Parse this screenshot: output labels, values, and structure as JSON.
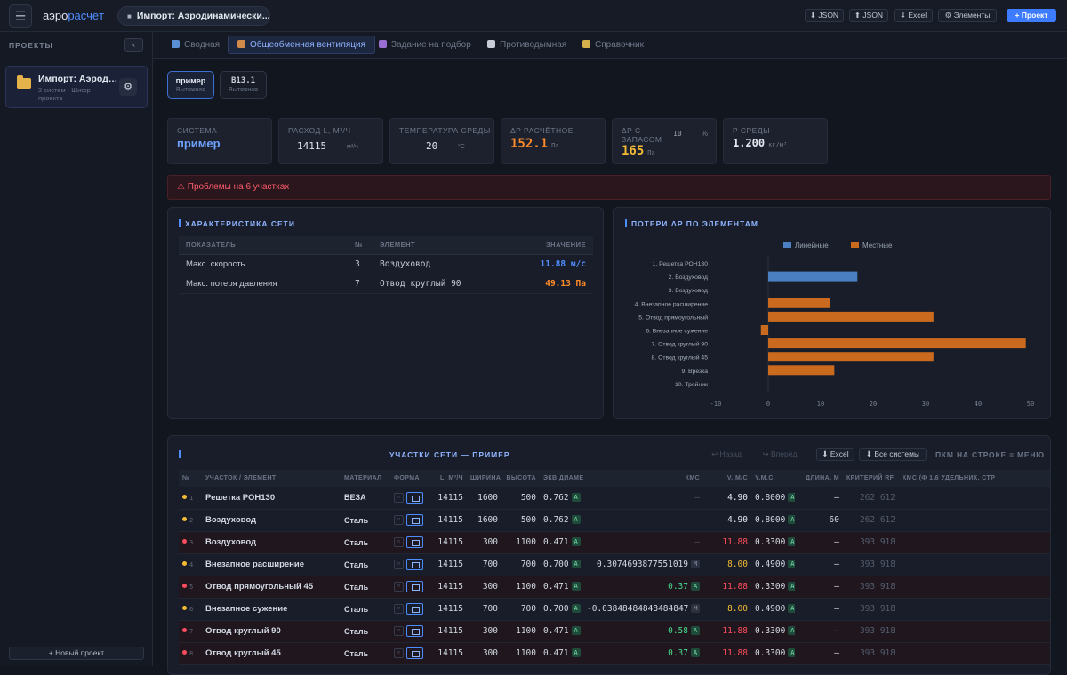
{
  "app": {
    "logo_a": "аэро",
    "logo_b": "расчёт",
    "menu_icon": "menu-icon",
    "project_pill": "Импорт: Аэродинамически..."
  },
  "toolbar": [
    {
      "id": "import-json",
      "label": "⬇ JSON"
    },
    {
      "id": "export-json",
      "label": "⬆ JSON"
    },
    {
      "id": "excel",
      "label": "⬇ Excel"
    },
    {
      "id": "elements",
      "label": "⚙ Элементы"
    },
    {
      "id": "new-project",
      "label": "+ Проект"
    }
  ],
  "sidebar": {
    "title": "ПРОЕКТЫ",
    "collapse": "‹",
    "project": {
      "name": "Импорт: Аэродинамический",
      "meta": "2 систем · Шифр проекта"
    },
    "new_project": "+ Новый проект"
  },
  "tabs": [
    {
      "label": "Сводная",
      "color": "#5a8fd6"
    },
    {
      "label": "Общеобменная вентиляция",
      "color": "#d08a4a"
    },
    {
      "label": "Задание на подбор",
      "color": "#9a6ed1"
    },
    {
      "label": "Противодымная",
      "color": "#c7ccd6"
    },
    {
      "label": "Справочник",
      "color": "#d6b04a"
    }
  ],
  "systems": [
    {
      "name": "пример",
      "type": "Вытяжная"
    },
    {
      "name": "В13.1",
      "type": "Вытяжная"
    }
  ],
  "kpis": {
    "system": {
      "label": "СИСТЕМА",
      "value": "пример"
    },
    "flow": {
      "label": "РАСХОД L, М³/Ч",
      "value": "14115",
      "unit": "м³/ч"
    },
    "temp": {
      "label": "ТЕМПЕРАТУРА СРЕДЫ",
      "value": "20",
      "unit": "°C"
    },
    "dp_calc": {
      "label": "ΔP РАСЧЁТНОЕ",
      "value": "152.1",
      "unit": "Па"
    },
    "dp_margin": {
      "label": "ΔP С ЗАПАСОМ",
      "percent": "10",
      "percent_unit": "%",
      "value": "165",
      "unit": "Па"
    },
    "density": {
      "label": "Ρ СРЕДЫ",
      "value": "1.200",
      "unit": "кг/м³"
    }
  },
  "alert": {
    "icon": "⚠",
    "text": "Проблемы на 6 участках"
  },
  "characteristics": {
    "title": "ХАРАКТЕРИСТИКА СЕТИ",
    "headers": [
      "ПОКАЗАТЕЛЬ",
      "№",
      "ЭЛЕМЕНТ",
      "ЗНАЧЕНИЕ"
    ],
    "rows": [
      {
        "param": "Макс. скорость",
        "n": "3",
        "element": "Воздуховод",
        "value": "11.88 м/с",
        "color": "#4f8dff"
      },
      {
        "param": "Макс. потеря давления",
        "n": "7",
        "element": "Отвод круглый 90",
        "value": "49.13 Па",
        "color": "#ff8a2a"
      }
    ]
  },
  "chart_data": {
    "type": "bar",
    "orientation": "horizontal",
    "title": "ПОТЕРИ ΔP ПО ЭЛЕМЕНТАМ",
    "categories": [
      "1. Решетка РОН130",
      "2. Воздуховод",
      "3. Воздуховод",
      "4. Внезапное расширение",
      "5. Отвод прямоугольный",
      "6. Внезапное сужение",
      "7. Отвод круглый 90",
      "8. Отвод круглый 45",
      "9. Врезка",
      "10. Тройник"
    ],
    "series": [
      {
        "name": "Линейные",
        "color": "#4a7fc1",
        "values": [
          0,
          17,
          0,
          0,
          0,
          0,
          0,
          0,
          0,
          0
        ]
      },
      {
        "name": "Местные",
        "color": "#c96a1e",
        "values": [
          0,
          0,
          0,
          11.8,
          31.5,
          -1.4,
          49.1,
          31.5,
          12.6,
          0
        ]
      }
    ],
    "xlim": [
      -10,
      50
    ],
    "xticks": [
      -10,
      0,
      10,
      20,
      30,
      40,
      50
    ],
    "legend": "top",
    "grid": false
  },
  "segments": {
    "title": "УЧАСТКИ СЕТИ — ПРИМЕР",
    "back": "↩ Назад",
    "forward": "↪ Вперёд",
    "excel": "⬇ Excel",
    "all_systems": "⬇ Все системы",
    "hint": "ПКМ НА СТРОКЕ = МЕНЮ",
    "headers": [
      "№",
      "УЧАСТОК / ЭЛЕМЕНТ",
      "МАТЕРИАЛ",
      "ФОРМА",
      "L, М³/Ч",
      "ШИРИНА",
      "ВЫСОТА",
      "ЭКВ ДИАМЕТР",
      "КМС",
      "V, М/С",
      "Y.M.C.",
      "ДЛИНА, М",
      "КРИТЕРИЙ RF",
      "КМС (Ф 1.6 УДЕЛЬНИК, СТР"
    ],
    "rows": [
      {
        "n": "1",
        "status": "#f4bb34",
        "name": "Решетка РОН130",
        "material": "ВЕЗА",
        "flow": "14115",
        "width": "1600",
        "height": "500",
        "de": "0.762",
        "kms": "—",
        "kms_badge": "",
        "v": "4.90",
        "v_color": "#e6ebf3",
        "ymc": "0.8000",
        "length": "—",
        "rf": "262 612",
        "bad": false
      },
      {
        "n": "2",
        "status": "#f4bb34",
        "name": "Воздуховод",
        "material": "Сталь",
        "flow": "14115",
        "width": "1600",
        "height": "500",
        "de": "0.762",
        "kms": "—",
        "kms_badge": "",
        "v": "4.90",
        "v_color": "#e6ebf3",
        "ymc": "0.8000",
        "length": "60",
        "rf": "262 612",
        "bad": false
      },
      {
        "n": "3",
        "status": "#ff4d5e",
        "name": "Воздуховод",
        "material": "Сталь",
        "flow": "14115",
        "width": "300",
        "height": "1100",
        "de": "0.471",
        "kms": "—",
        "kms_badge": "",
        "v": "11.88",
        "v_color": "#ff4d5e",
        "ymc": "0.3300",
        "length": "—",
        "rf": "393 918",
        "bad": true
      },
      {
        "n": "4",
        "status": "#f4bb34",
        "name": "Внезапное расширение",
        "material": "Сталь",
        "flow": "14115",
        "width": "700",
        "height": "700",
        "de": "0.700",
        "kms": "0.3074693877551019",
        "kms_badge": "M",
        "v": "8.00",
        "v_color": "#f4bb34",
        "ymc": "0.4900",
        "length": "—",
        "rf": "393 918",
        "bad": false
      },
      {
        "n": "5",
        "status": "#ff4d5e",
        "name": "Отвод прямоугольный 45",
        "material": "Сталь",
        "flow": "14115",
        "width": "300",
        "height": "1100",
        "de": "0.471",
        "kms": "0.37",
        "kms_badge": "A",
        "v": "11.88",
        "v_color": "#ff4d5e",
        "ymc": "0.3300",
        "length": "—",
        "rf": "393 918",
        "bad": true
      },
      {
        "n": "6",
        "status": "#f4bb34",
        "name": "Внезапное сужение",
        "material": "Сталь",
        "flow": "14115",
        "width": "700",
        "height": "700",
        "de": "0.700",
        "kms": "-0.03848484848484847",
        "kms_badge": "M",
        "v": "8.00",
        "v_color": "#f4bb34",
        "ymc": "0.4900",
        "length": "—",
        "rf": "393 918",
        "bad": false
      },
      {
        "n": "7",
        "status": "#ff4d5e",
        "name": "Отвод круглый 90",
        "material": "Сталь",
        "flow": "14115",
        "width": "300",
        "height": "1100",
        "de": "0.471",
        "kms": "0.58",
        "kms_badge": "A",
        "v": "11.88",
        "v_color": "#ff4d5e",
        "ymc": "0.3300",
        "length": "—",
        "rf": "393 918",
        "bad": true
      },
      {
        "n": "8",
        "status": "#ff4d5e",
        "name": "Отвод круглый 45",
        "material": "Сталь",
        "flow": "14115",
        "width": "300",
        "height": "1100",
        "de": "0.471",
        "kms": "0.37",
        "kms_badge": "A",
        "v": "11.88",
        "v_color": "#ff4d5e",
        "ymc": "0.3300",
        "length": "—",
        "rf": "393 918",
        "bad": true
      }
    ]
  }
}
